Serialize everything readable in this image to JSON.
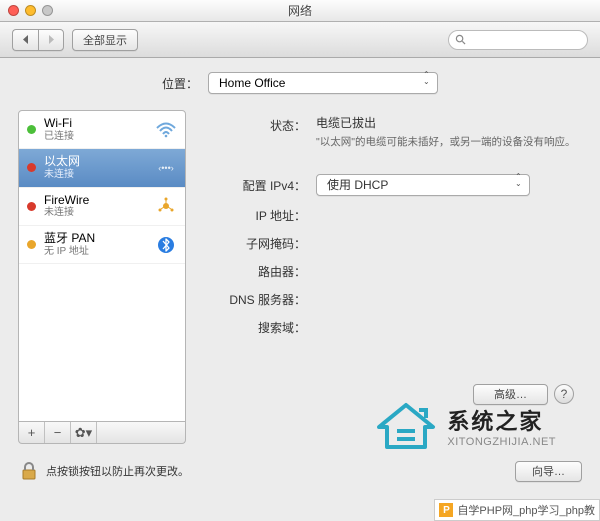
{
  "window": {
    "title": "网络"
  },
  "toolbar": {
    "show_all": "全部显示"
  },
  "location": {
    "label": "位置：",
    "value": "Home Office"
  },
  "sidebar": {
    "items": [
      {
        "name": "Wi-Fi",
        "status": "已连接",
        "dot": "g",
        "icon": "wifi"
      },
      {
        "name": "以太网",
        "status": "未连接",
        "dot": "r",
        "icon": "ethernet"
      },
      {
        "name": "FireWire",
        "status": "未连接",
        "dot": "r",
        "icon": "firewire"
      },
      {
        "name": "蓝牙 PAN",
        "status": "无 IP 地址",
        "dot": "o",
        "icon": "bluetooth"
      }
    ]
  },
  "details": {
    "status_label": "状态：",
    "status_value": "电缆已拔出",
    "status_hint": "\"以太网\"的电缆可能未插好，或另一端的设备没有响应。",
    "ipv4_label": "配置 IPv4：",
    "ipv4_value": "使用 DHCP",
    "ip_label": "IP 地址：",
    "subnet_label": "子网掩码：",
    "router_label": "路由器：",
    "dns_label": "DNS 服务器：",
    "search_label": "搜索域：",
    "advanced": "高级…"
  },
  "footer": {
    "lock_text": "点按锁按钮以防止再次更改。",
    "assist": "向导…"
  },
  "watermark": {
    "line1": "系统之家",
    "line2": "XITONGZHIJIA.NET"
  },
  "badge": {
    "text": "自学PHP网_php学习_php教"
  }
}
